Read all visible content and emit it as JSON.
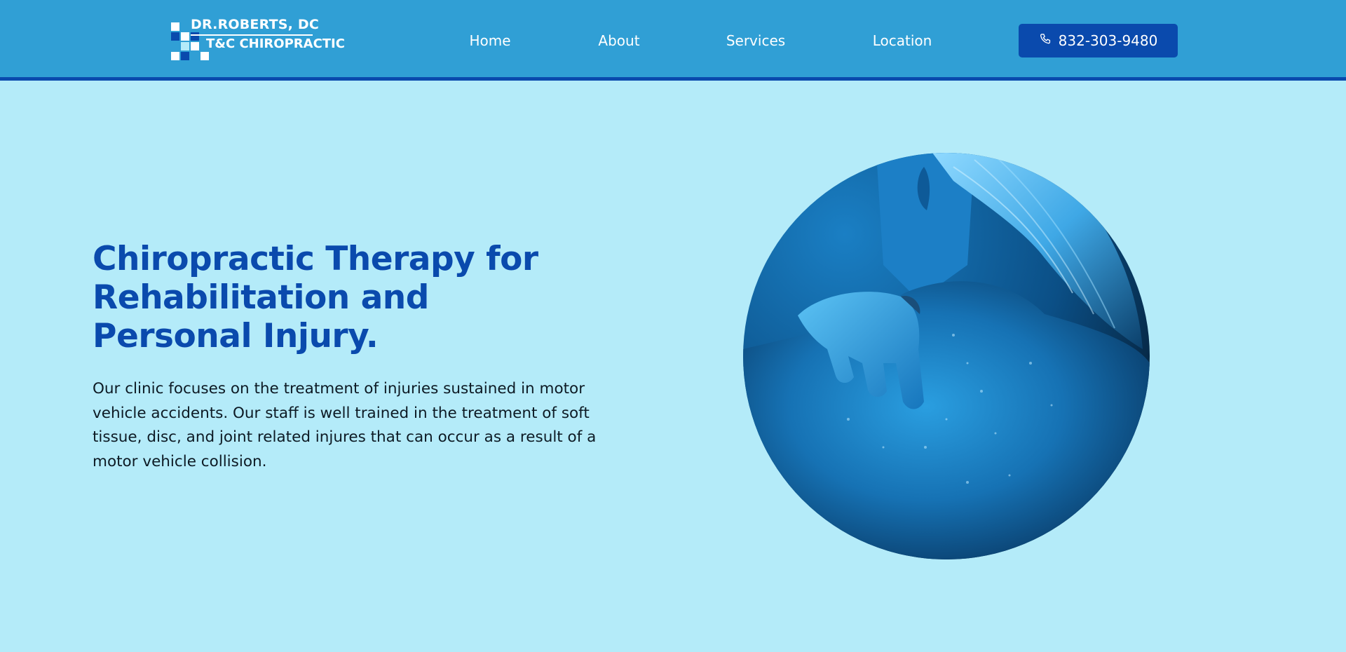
{
  "brand": {
    "line1": "DR.ROBERTS, DC",
    "line2": "T&C CHIROPRACTIC",
    "colors": {
      "light": "#ffffff",
      "dark": "#0a4aad",
      "pale": "#b4ebf9"
    }
  },
  "nav": {
    "items": [
      {
        "label": "Home"
      },
      {
        "label": "About"
      },
      {
        "label": "Services"
      },
      {
        "label": "Location"
      }
    ]
  },
  "phone": {
    "icon": "phone-icon",
    "label": "832-303-9480"
  },
  "hero": {
    "title": "Chiropractic Therapy for Rehabilitation and Personal Injury.",
    "body": "Our clinic focuses on the treatment of injuries sustained in motor vehicle accidents. Our staff is well trained in the treatment of soft tissue, disc, and joint related injures that can occur as a result of a motor vehicle collision."
  },
  "theme": {
    "header_bg": "#309fd5",
    "accent": "#0a4aad",
    "page_bg": "#b4ebf9",
    "text": "#0d1a24"
  }
}
